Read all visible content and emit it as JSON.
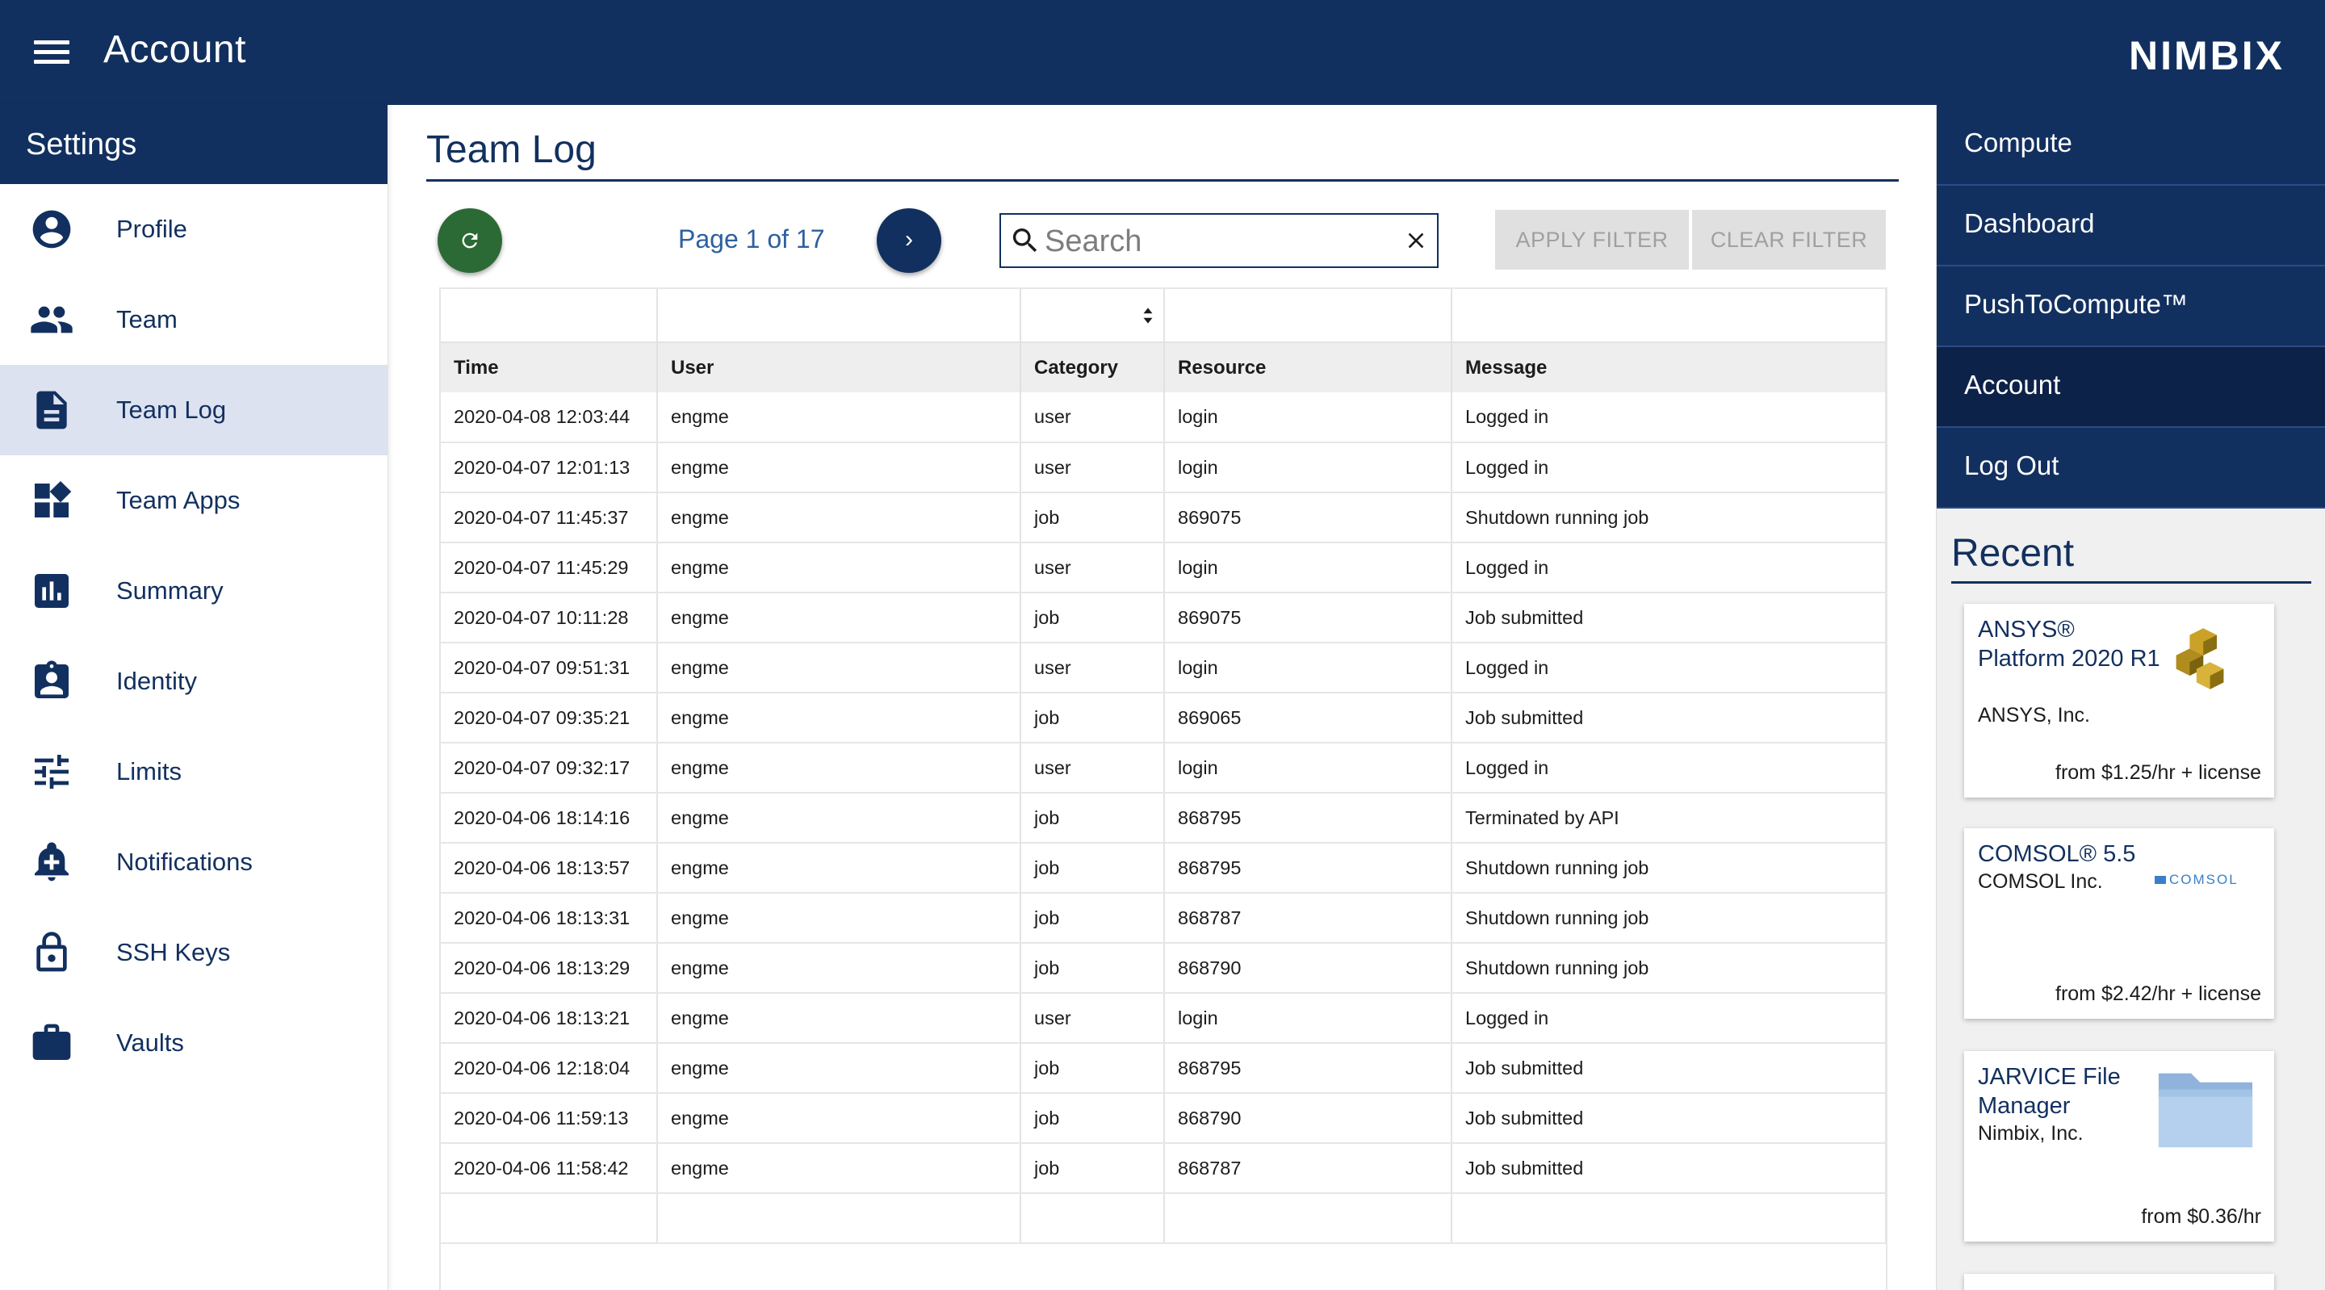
{
  "header": {
    "title": "Account",
    "brand": "NIMBIX"
  },
  "sidebar": {
    "title": "Settings",
    "items": [
      {
        "label": "Profile",
        "icon": "account-circle-icon"
      },
      {
        "label": "Team",
        "icon": "people-icon"
      },
      {
        "label": "Team Log",
        "icon": "document-icon",
        "active": true
      },
      {
        "label": "Team Apps",
        "icon": "widgets-icon"
      },
      {
        "label": "Summary",
        "icon": "bar-chart-icon"
      },
      {
        "label": "Identity",
        "icon": "badge-icon"
      },
      {
        "label": "Limits",
        "icon": "sliders-icon"
      },
      {
        "label": "Notifications",
        "icon": "bell-plus-icon"
      },
      {
        "label": "SSH Keys",
        "icon": "lock-icon"
      },
      {
        "label": "Vaults",
        "icon": "briefcase-icon"
      }
    ]
  },
  "main": {
    "title": "Team Log",
    "page_info": "Page 1 of 17",
    "next_symbol": "›",
    "search": {
      "placeholder": "Search",
      "value": ""
    },
    "apply_filter": "APPLY FILTER",
    "clear_filter": "CLEAR FILTER"
  },
  "table": {
    "headers": [
      "Time",
      "User",
      "Category",
      "Resource",
      "Message"
    ],
    "rows": [
      [
        "2020-04-08 12:03:44",
        "engme",
        "user",
        "login",
        "Logged in"
      ],
      [
        "2020-04-07 12:01:13",
        "engme",
        "user",
        "login",
        "Logged in"
      ],
      [
        "2020-04-07 11:45:37",
        "engme",
        "job",
        "869075",
        "Shutdown running job"
      ],
      [
        "2020-04-07 11:45:29",
        "engme",
        "user",
        "login",
        "Logged in"
      ],
      [
        "2020-04-07 10:11:28",
        "engme",
        "job",
        "869075",
        "Job submitted"
      ],
      [
        "2020-04-07 09:51:31",
        "engme",
        "user",
        "login",
        "Logged in"
      ],
      [
        "2020-04-07 09:35:21",
        "engme",
        "job",
        "869065",
        "Job submitted"
      ],
      [
        "2020-04-07 09:32:17",
        "engme",
        "user",
        "login",
        "Logged in"
      ],
      [
        "2020-04-06 18:14:16",
        "engme",
        "job",
        "868795",
        "Terminated by API"
      ],
      [
        "2020-04-06 18:13:57",
        "engme",
        "job",
        "868795",
        "Shutdown running job"
      ],
      [
        "2020-04-06 18:13:31",
        "engme",
        "job",
        "868787",
        "Shutdown running job"
      ],
      [
        "2020-04-06 18:13:29",
        "engme",
        "job",
        "868790",
        "Shutdown running job"
      ],
      [
        "2020-04-06 18:13:21",
        "engme",
        "user",
        "login",
        "Logged in"
      ],
      [
        "2020-04-06 12:18:04",
        "engme",
        "job",
        "868795",
        "Job submitted"
      ],
      [
        "2020-04-06 11:59:13",
        "engme",
        "job",
        "868790",
        "Job submitted"
      ],
      [
        "2020-04-06 11:58:42",
        "engme",
        "job",
        "868787",
        "Job submitted"
      ]
    ]
  },
  "rightnav": {
    "items": [
      {
        "label": "Compute"
      },
      {
        "label": "Dashboard"
      },
      {
        "label": "PushToCompute™"
      },
      {
        "label": "Account",
        "active": true
      },
      {
        "label": "Log Out"
      }
    ],
    "recent_title": "Recent"
  },
  "recent": [
    {
      "title": "ANSYS® Platform 2020 R1",
      "vendor": "ANSYS, Inc.",
      "price": "from $1.25/hr + license",
      "logo": "ansys-cubes-icon"
    },
    {
      "title": "COMSOL® 5.5",
      "vendor": "COMSOL Inc.",
      "price": "from $2.42/hr + license",
      "logo": "comsol-logo",
      "logo_text": "COMSOL"
    },
    {
      "title": "JARVICE File Manager",
      "vendor": "Nimbix, Inc.",
      "price": "from $0.36/hr",
      "logo": "folder-icon"
    }
  ],
  "colors": {
    "primary": "#12305f",
    "active_side": "#dde2f0",
    "refresh": "#2c6a35",
    "link": "#2d5fa0"
  }
}
